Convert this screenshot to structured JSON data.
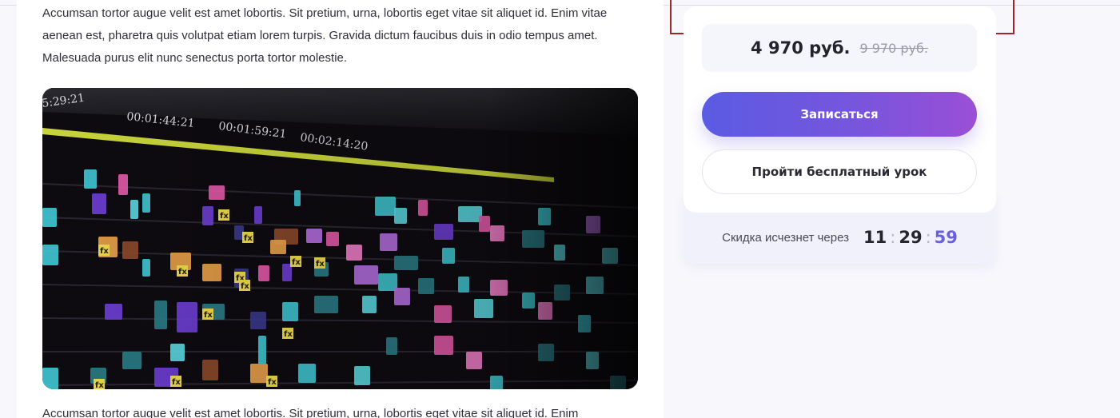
{
  "article": {
    "paragraph_1": "Accumsan tortor augue velit est amet lobortis. Sit pretium, urna, lobortis eget vitae sit aliquet id. Enim vitae aenean est, pharetra quis volutpat etiam lorem turpis. Gravida dictum faucibus duis in odio tempus amet. Malesuada purus elit nunc senectus porta tortor molestie.",
    "paragraph_2": "Accumsan tortor augue velit est amet lobortis. Sit pretium, urna, lobortis eget vitae sit aliquet id. Enim",
    "image": {
      "subject": "video-editing-timeline",
      "timecodes": [
        "5:29:21",
        "00:01:44:21",
        "00:01:59:21",
        "00:02:14:20"
      ],
      "clip_label": "fx"
    }
  },
  "sidebar": {
    "price_current": "4 970 руб.",
    "price_old": "9 970 руб.",
    "enroll_button": "Записаться",
    "free_lesson_button": "Пройти бесплатный урок",
    "discount_label": "Скидка исчезнет через",
    "timer": {
      "hours": "11",
      "minutes": "29",
      "seconds": "59",
      "separator": ":"
    }
  },
  "colors": {
    "accent_start": "#5b5be3",
    "accent_end": "#9a4fd6",
    "timer_seconds": "#6a5fe0",
    "outline_box": "#a3232b"
  }
}
